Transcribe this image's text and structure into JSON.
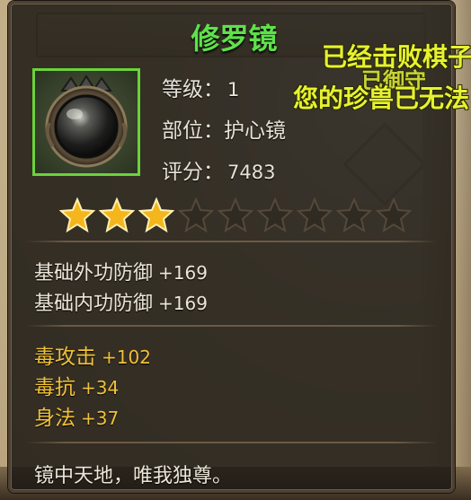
{
  "item": {
    "name": "修罗镜",
    "name_color": "#5ee14a",
    "icon": "dark-orb-mirror-icon",
    "level_label": "等级：",
    "level_value": "1",
    "slot_label": "部位：",
    "slot_value": "护心镜",
    "score_label": "评分：",
    "score_value": "7483",
    "stars_total": 9,
    "stars_filled": 3
  },
  "base_attributes": [
    {
      "name": "基础外功防御",
      "value": "+169"
    },
    {
      "name": "基础内功防御",
      "value": "+169"
    }
  ],
  "bonus_attributes": [
    {
      "name": "毒攻击",
      "value": "+102"
    },
    {
      "name": "毒抗",
      "value": "+34"
    },
    {
      "name": "身法",
      "value": "+37"
    }
  ],
  "description": "镜中天地，唯我独尊。",
  "notifications": {
    "line1": "已经击败棋子",
    "line1_partial": "已御守",
    "line2": "您的珍兽已无法"
  },
  "colors": {
    "gold": "#f1c138",
    "star_filled": "#f5b51c",
    "star_empty": "#2f2a22",
    "notice": "#e6f230"
  }
}
